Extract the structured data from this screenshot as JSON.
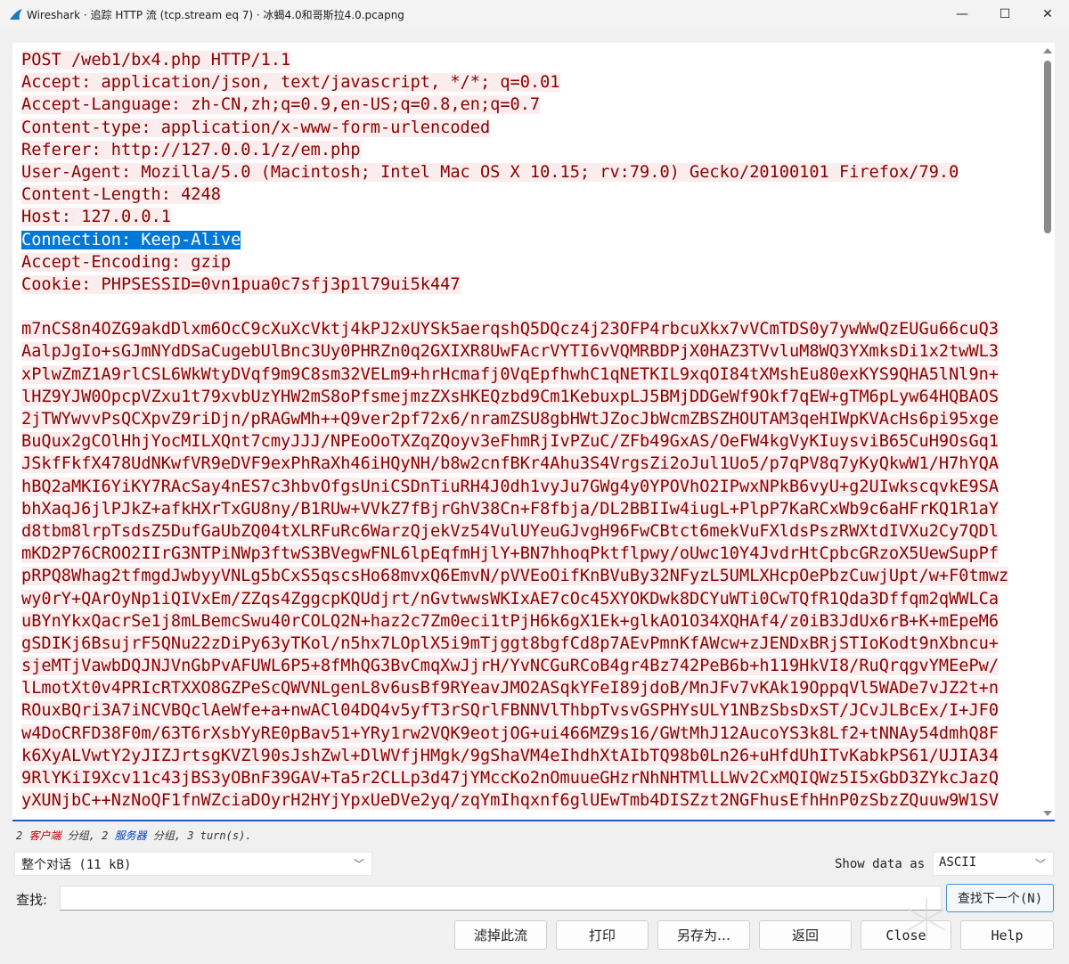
{
  "window": {
    "title": "Wireshark · 追踪 HTTP 流 (tcp.stream eq 7) · 冰蝎4.0和哥斯拉4.0.pcapng",
    "minimize": "—",
    "maximize": "☐",
    "close": "✕"
  },
  "stream": {
    "lines": [
      {
        "text": "POST /web1/bx4.php HTTP/1.1",
        "selected": false
      },
      {
        "text": "Accept: application/json, text/javascript, */*; q=0.01",
        "selected": false
      },
      {
        "text": "Accept-Language: zh-CN,zh;q=0.9,en-US;q=0.8,en;q=0.7",
        "selected": false
      },
      {
        "text": "Content-type: application/x-www-form-urlencoded",
        "selected": false
      },
      {
        "text": "Referer: http://127.0.0.1/z/em.php",
        "selected": false
      },
      {
        "text": "User-Agent: Mozilla/5.0 (Macintosh; Intel Mac OS X 10.15; rv:79.0) Gecko/20100101 Firefox/79.0",
        "selected": false
      },
      {
        "text": "Content-Length: 4248",
        "selected": false
      },
      {
        "text": "Host: 127.0.0.1",
        "selected": false
      },
      {
        "text": "Connection: Keep-Alive",
        "selected": true
      },
      {
        "text": "Accept-Encoding: gzip",
        "selected": false
      },
      {
        "text": "Cookie: PHPSESSID=0vn1pua0c7sfj3p1l79ui5k447",
        "selected": false
      },
      {
        "text": "",
        "selected": false
      },
      {
        "text": "m7nCS8n4OZG9akdDlxm6OcC9cXuXcVktj4kPJ2xUYSk5aerqshQ5DQcz4j23OFP4rbcuXkx7vVCmTDS0y7ywWwQzEUGu66cuQ3",
        "selected": false
      },
      {
        "text": "AalpJgIo+sGJmNYdDSaCugebUlBnc3Uy0PHRZn0q2GXIXR8UwFAcrVYTI6vVQMRBDPjX0HAZ3TVvluM8WQ3YXmksDi1x2twWL3",
        "selected": false
      },
      {
        "text": "xPlwZmZ1A9rlCSL6WkWtyDVqf9m9C8sm32VELm9+hrHcmafj0VqEpfhwhC1qNETKIL9xqOI84tXMshEu80exKYS9QHA5lNl9n+",
        "selected": false
      },
      {
        "text": "lHZ9YJW0OpcpVZxu1t79xvbUzYHW2mS8oPfsmejmzZXsHKEQzbd9Cm1KebuxpLJ5BMjDDGeWf9Okf7qEW+gTM6pLyw64HQBAOS",
        "selected": false
      },
      {
        "text": "2jTWYwvvPsQCXpvZ9riDjn/pRAGwMh++Q9ver2pf72x6/nramZSU8gbHWtJZocJbWcmZBSZHOUTAM3qeHIWpKVAcHs6pi95xge",
        "selected": false
      },
      {
        "text": "BuQux2gCOlHhjYocMILXQnt7cmyJJJ/NPEoOoTXZqZQoyv3eFhmRjIvPZuC/ZFb49GxAS/OeFW4kgVyKIuysviB65CuH9OsGq1",
        "selected": false
      },
      {
        "text": "JSkfFkfX478UdNKwfVR9eDVF9exPhRaXh46iHQyNH/b8w2cnfBKr4Ahu3S4VrgsZi2oJul1Uo5/p7qPV8q7yKyQkwW1/H7hYQA",
        "selected": false
      },
      {
        "text": "hBQ2aMKI6YiKY7RAcSay4nES7c3hbvOfgsUniCSDnTiuRH4J0dh1vyJu7GWg4y0YPOVhO2IPwxNPkB6vyU+g2UIwkscqvkE9SA",
        "selected": false
      },
      {
        "text": "bhXaqJ6jlPJkZ+afkHXrTxGU8ny/B1RUw+VVkZ7fBjrGhV38Cn+F8fbja/DL2BBIIw4iugL+PlpP7KaRCxWb9c6aHFrKQ1R1aY",
        "selected": false
      },
      {
        "text": "d8tbm8lrpTsdsZ5DufGaUbZQ04tXLRFuRc6WarzQjekVz54VulUYeuGJvgH96FwCBtct6mekVuFXldsPszRWXtdIVXu2Cy7QDl",
        "selected": false
      },
      {
        "text": "mKD2P76CROO2IIrG3NTPiNWp3ftwS3BVegwFNL6lpEqfmHjlY+BN7hhoqPktflpwy/oUwc10Y4JvdrHtCpbcGRzoX5UewSupPf",
        "selected": false
      },
      {
        "text": "pRPQ8Whag2tfmgdJwbyyVNLg5bCxS5qscsHo68mvxQ6EmvN/pVVEoOifKnBVuBy32NFyzL5UMLXHcpOePbzCuwjUpt/w+F0tmwz",
        "selected": false
      },
      {
        "text": "wy0rY+QArOyNp1iQIVxEm/ZZqs4ZggcpKQUdjrt/nGvtwwsWKIxAE7cOc45XYOKDwk8DCYuWTi0CwTQfR1Qda3Dffqm2qWWLCa",
        "selected": false
      },
      {
        "text": "uBYnYkxQacrSe1j8mLBemcSwu40rCOLQ2N+haz2c7Zm0eci1tPjH6k6gX1Ek+glkAO1O34XQHAf4/z0iB3JdUx6rB+K+mEpeM6",
        "selected": false
      },
      {
        "text": "gSDIKj6BsujrF5QNu22zDiPy63yTKol/n5hx7LOplX5i9mTjggt8bgfCd8p7AEvPmnKfAWcw+zJENDxBRjSTIoKodt9nXbncu+",
        "selected": false
      },
      {
        "text": "sjeMTjVawbDQJNJVnGbPvAFUWL6P5+8fMhQG3BvCmqXwJjrH/YvNCGuRCoB4gr4Bz742PeB6b+h119HkVI8/RuQrqgvYMEePw/",
        "selected": false
      },
      {
        "text": "lLmotXt0v4PRIcRTXXO8GZPeScQWVNLgenL8v6usBf9RYeavJMO2ASqkYFeI89jdoB/MnJFv7vKAk19OppqVl5WADe7vJZ2t+n",
        "selected": false
      },
      {
        "text": "ROuxBQri3A7iNCVBQclAeWfe+a+nwACl04DQ4v5yfT3rSQrlFBNNVlThbpTvsvGSPHYsULY1NBzSbsDxST/JCvJLBcEx/I+JF0",
        "selected": false
      },
      {
        "text": "w4DoCRFD38F0m/63T6rXsbYyRE0pBav51+YRy1rw2VQK9eotjOG+ui466MZ9s16/GWtMhJ12AucoYS3k8Lf2+tNNAy54dmhQ8F",
        "selected": false
      },
      {
        "text": "k6XyALVwtY2yJIZJrtsgKVZl90sJshZwl+DlWVfjHMgk/9gShaVM4eIhdhXtAIbTQ98b0Ln26+uHfdUhITvKabkPS61/UJIA34",
        "selected": false
      },
      {
        "text": "9RlYKiI9Xcv11c43jBS3yOBnF39GAV+Ta5r2CLLp3d47jYMccKo2nOmuueGHzrNhNHTMlLLWv2CxMQIQWz5I5xGbD3ZYkcJazQ",
        "selected": false
      },
      {
        "text": "yXUNjbC++NzNoQF1fnWZciaDOyrH2HYjYpxUeDVe2yq/zqYmIhqxnf6glUEwTmb4DISZzt2NGFhusEfhHnP0zSbzZQuuw9W1SV",
        "selected": false
      }
    ]
  },
  "summary": {
    "prefix": "2 ",
    "client": "客户端",
    "mid1": " 分组, 2 ",
    "server": "服务器",
    "mid2": " 分组, 3 turn(s)."
  },
  "controls": {
    "conversation_select": "整个对话 (11 kB)",
    "show_data_as_label": "Show data as",
    "show_data_as_value": "ASCII",
    "find_label": "查找:",
    "find_value": "",
    "find_next_label": "查找下一个(N)"
  },
  "buttons": {
    "filter_out": "滤掉此流",
    "print": "打印",
    "save_as": "另存为…",
    "back": "返回",
    "close": "Close",
    "help": "Help"
  },
  "colors": {
    "stream_text": "#8b0000",
    "stream_bg": "#fbeded",
    "selection": "#0078d7",
    "accent_border": "#4a90d9"
  }
}
